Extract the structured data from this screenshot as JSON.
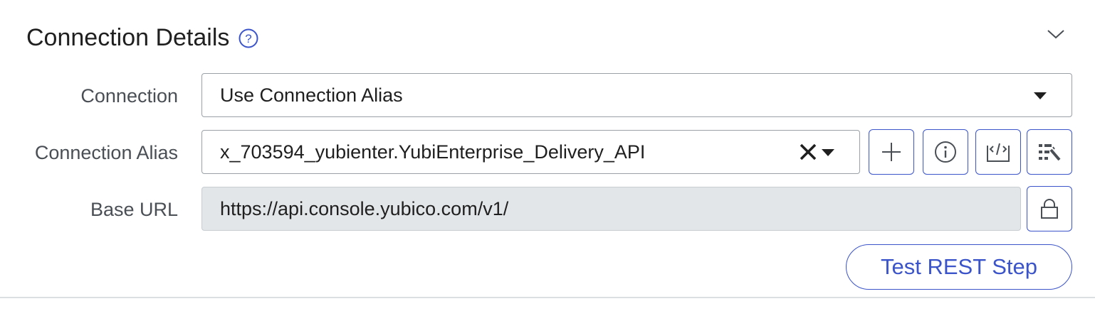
{
  "section": {
    "title": "Connection Details",
    "help_icon": "question-circle-icon",
    "collapse_icon": "chevron-down-icon"
  },
  "connection": {
    "label": "Connection",
    "value": "Use Connection Alias",
    "icon": "caret-down-icon"
  },
  "connection_alias": {
    "label": "Connection Alias",
    "value": "x_703594_yubienter.YubiEnterprise_Delivery_API",
    "clear_icon": "close-icon",
    "dropdown_icon": "caret-down-icon",
    "actions": [
      "plus-icon",
      "info-icon",
      "script-icon",
      "wand-icon"
    ]
  },
  "base_url": {
    "label": "Base URL",
    "value": "https://api.console.yubico.com/v1/",
    "lock_icon": "lock-icon"
  },
  "test_button": {
    "label": "Test REST Step"
  },
  "colors": {
    "accent": "#3b54c9",
    "label_text": "#4a4f55",
    "readonly_bg": "#e3e6e8",
    "border": "#9aa0a6"
  }
}
